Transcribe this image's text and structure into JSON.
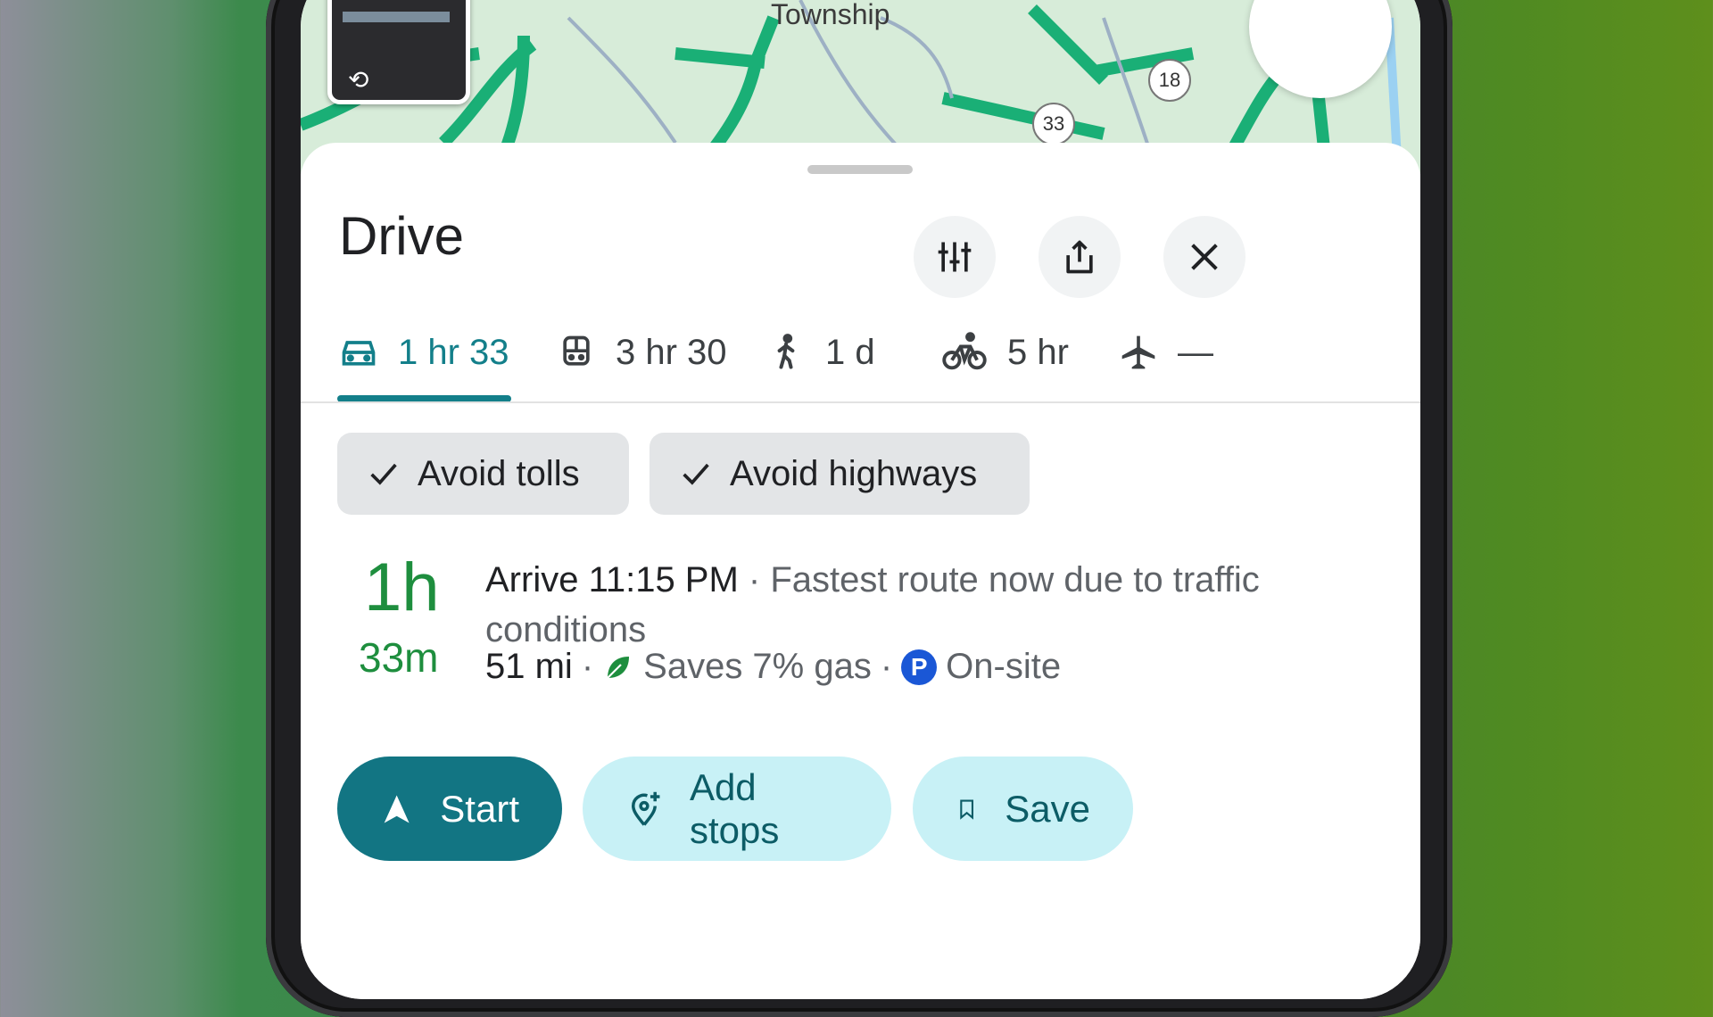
{
  "map": {
    "label": "Township",
    "route_badges": [
      "18",
      "33"
    ]
  },
  "sheet": {
    "title": "Drive"
  },
  "modes": [
    {
      "name": "drive",
      "label": "1 hr 33",
      "icon": "car-icon",
      "active": true
    },
    {
      "name": "transit",
      "label": "3 hr 30",
      "icon": "train-icon"
    },
    {
      "name": "walk",
      "label": "1 d",
      "icon": "walk-icon"
    },
    {
      "name": "bike",
      "label": "5 hr",
      "icon": "bike-icon"
    },
    {
      "name": "flight",
      "label": "—",
      "icon": "plane-icon"
    }
  ],
  "chips": {
    "avoid_tolls": "Avoid tolls",
    "avoid_highways": "Avoid highways"
  },
  "route": {
    "eta_hours": "1h",
    "eta_minutes": "33m",
    "arrive": "Arrive 11:15 PM",
    "sep": " · ",
    "note_part1": "Fastest route now due to traffic",
    "note_part2": "conditions",
    "distance": "51 mi",
    "gas": "Saves 7% gas",
    "parking_badge": "P",
    "parking": "On-site"
  },
  "actions": {
    "start": "Start",
    "add_stops": "Add stops",
    "save": "Save"
  },
  "colors": {
    "accent": "#137f8a",
    "eta_green": "#1e8e3e",
    "primary_button": "#127583",
    "tonal_button": "#c8f1f6",
    "parking_blue": "#1a57d6"
  }
}
